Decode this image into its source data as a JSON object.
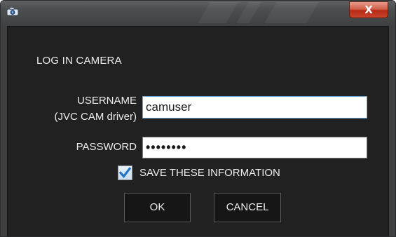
{
  "titlebar": {
    "close_label": "X"
  },
  "dialog": {
    "heading": "LOG IN CAMERA",
    "username": {
      "label_line1": "USERNAME",
      "label_line2": "(JVC CAM driver)",
      "value": "camuser"
    },
    "password": {
      "label": "PASSWORD",
      "value": "••••••••"
    },
    "save_info": {
      "label": "SAVE THESE INFORMATION",
      "checked": true
    },
    "ok_label": "OK",
    "cancel_label": "CANCEL"
  },
  "icons": {
    "app": "camera-icon",
    "close": "close-icon",
    "check": "checkmark-icon"
  },
  "colors": {
    "frame": "#4c4e50",
    "client_bg": "#212121",
    "text": "#ececec",
    "close_red": "#c9452d",
    "check_blue": "#1f74c8",
    "focus_border": "#6aa7d8"
  }
}
